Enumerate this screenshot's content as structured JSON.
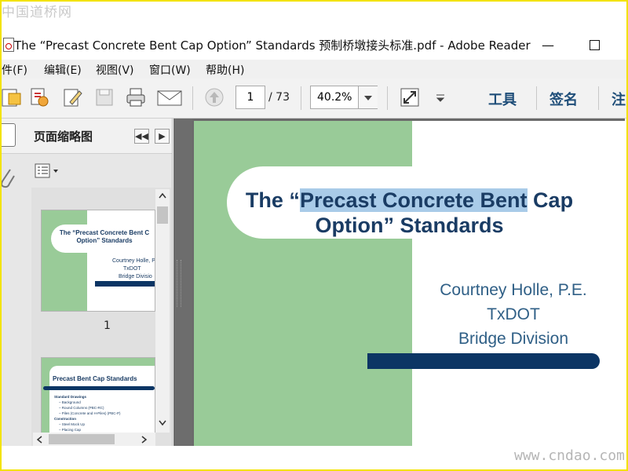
{
  "watermark_top": "中国道桥网",
  "watermark_bottom": "www.cndao.com",
  "window": {
    "title": "The “Precast Concrete Bent Cap Option” Standards 预制桥墩接头标准.pdf - Adobe Reader",
    "minimize": "—"
  },
  "menu": [
    "件(F)",
    "编辑(E)",
    "视图(V)",
    "窗口(W)",
    "帮助(H)"
  ],
  "toolbar": {
    "page_current": "1",
    "page_total": "/ 73",
    "zoom": "40.2%",
    "tools_label": "工具",
    "sign_label": "签名",
    "comment_label": "注"
  },
  "sidebar": {
    "title": "页面缩略图",
    "thumbs": [
      {
        "number": "1",
        "title": "The “Precast Concrete Bent C Option” Standards",
        "author_lines": [
          "Courtney Holle, P",
          "TxDOT",
          "Bridge Divisio"
        ]
      },
      {
        "title": "Precast Bent Cap Standards",
        "bullets": [
          "Standard Drawings",
          "– Background",
          "– Round Columns (PBC-RC)",
          "– Piles (Concrete and H-Piles) (PBC-P)",
          "Construction",
          "– Steel Mock Up",
          "– Placing Cap"
        ]
      }
    ]
  },
  "slide": {
    "title_pre": "The “",
    "title_highlight": "Precast Concrete Bent",
    "title_post": " Cap",
    "title_line2": "Option” Standards",
    "author_lines": [
      "Courtney Holle, P.E.",
      "TxDOT",
      "Bridge Division"
    ]
  },
  "colors": {
    "slide_green": "#99cb98",
    "title_navy": "#1a3c64",
    "author_blue": "#2f5f86",
    "bar_navy": "#0c3564",
    "highlight": "#a9cbe8",
    "frame_yellow": "#f3e300"
  }
}
